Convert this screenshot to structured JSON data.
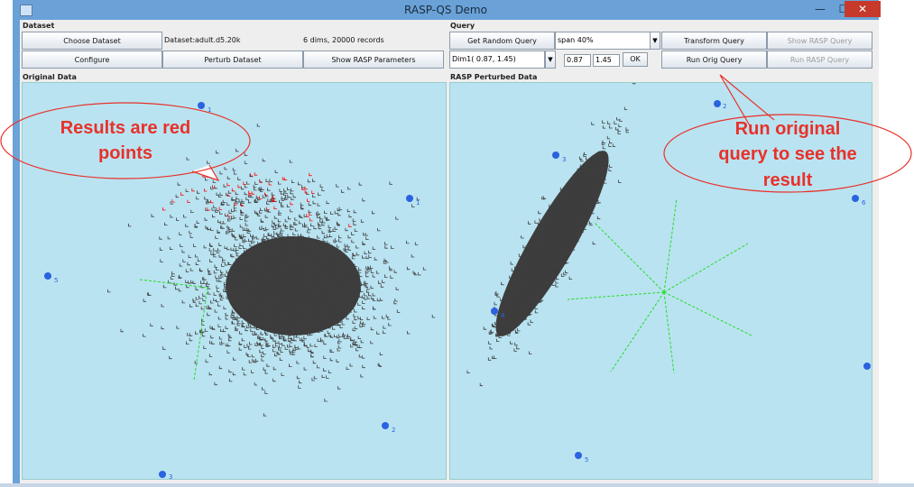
{
  "window": {
    "title": "RASP-QS Demo",
    "minimize_glyph": "—",
    "maximize_glyph": "☐",
    "close_glyph": "✕"
  },
  "dataset_panel": {
    "label": "Dataset",
    "choose_button": "Choose Dataset",
    "dataset_name": "Dataset:adult.d5.20k",
    "dataset_info": "6 dims, 20000 records",
    "configure_button": "Configure",
    "perturb_button": "Perturb Dataset",
    "show_params_button": "Show RASP Parameters"
  },
  "query_panel": {
    "label": "Query",
    "random_query_button": "Get Random Query",
    "span_select_value": "span 40%",
    "transform_button": "Transform Query",
    "show_rasp_query_button": "Show RASP Query",
    "dim_select_value": "Dim1( 0.87, 1.45)",
    "range_min_value": "0.87",
    "range_max_value": "1.45",
    "ok_button": "OK",
    "run_orig_button": "Run Orig Query",
    "run_rasp_button": "Run RASP Query"
  },
  "original_plot": {
    "label": "Original Data",
    "anchors": [
      "1",
      "1",
      "5",
      "2",
      "3"
    ]
  },
  "perturbed_plot": {
    "label": "RASP Perturbed Data",
    "anchors": [
      "2",
      "3",
      "4",
      "5",
      "6",
      "7"
    ]
  },
  "annotations": {
    "left_callout": [
      "Results are red",
      "points"
    ],
    "right_callout": [
      "Run original",
      "query to see the",
      "result"
    ],
    "callout_color": "#e8312a"
  },
  "colors": {
    "titlebar": "#6aa2d8",
    "plot_bg": "#b9e3f1",
    "points": "#3d3d3d",
    "result_points": "#ff0000",
    "anchor": "#2b62e0",
    "axis_lines": "#22dd22"
  }
}
